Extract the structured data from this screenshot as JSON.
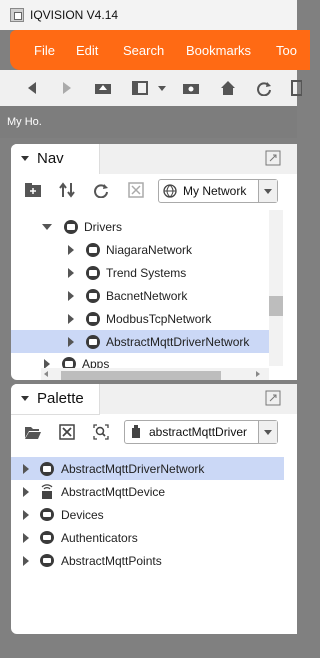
{
  "window": {
    "title": "IQVISION V4.14"
  },
  "menu": {
    "items": [
      "File",
      "Edit",
      "Search",
      "Bookmarks",
      "Too"
    ]
  },
  "path": {
    "text": "My Ho."
  },
  "nav": {
    "title": "Nav",
    "dropdown_value": "My Network",
    "tree": {
      "drivers": "Drivers",
      "children": [
        "NiagaraNetwork",
        "Trend Systems",
        "BacnetNetwork",
        "ModbusTcpNetwork",
        "AbstractMqttDriverNetwork"
      ],
      "next": "Apps"
    }
  },
  "palette": {
    "title": "Palette",
    "dropdown_value": "abstractMqttDriver",
    "items": [
      "AbstractMqttDriverNetwork",
      "AbstractMqttDevice",
      "Devices",
      "Authenticators",
      "AbstractMqttPoints"
    ]
  },
  "colors": {
    "accent": "#ff6a14",
    "selection": "#cbd8f6"
  }
}
